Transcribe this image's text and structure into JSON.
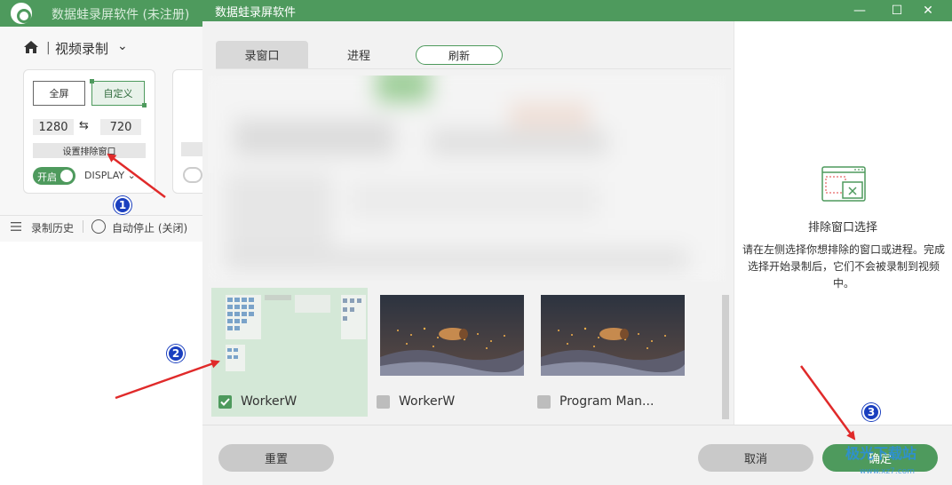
{
  "background_app": {
    "title": "数据蛙录屏软件 (未注册)",
    "mode_label": "视频录制",
    "separator": "|",
    "fullscreen_label": "全屏",
    "custom_label": "自定义",
    "width": "1280",
    "height": "720",
    "exclude_button": "设置排除窗口",
    "toggle_label": "开启",
    "display_label": "DISPLAY",
    "history_label": "录制历史",
    "autostop_label": "自动停止 (关闭)"
  },
  "dialog": {
    "title": "数据蛙录屏软件",
    "tabs": {
      "window": "录窗口",
      "process": "进程",
      "refresh": "刷新"
    },
    "thumbnails": [
      {
        "label": "WorkerW",
        "checked": true
      },
      {
        "label": "WorkerW",
        "checked": false
      },
      {
        "label": "Program Man...",
        "checked": false
      }
    ],
    "right_panel": {
      "title": "排除窗口选择",
      "description": "请在左侧选择你想排除的窗口或进程。完成选择开始录制后，它们不会被录制到视频中。"
    },
    "buttons": {
      "reset": "重置",
      "cancel": "取消",
      "ok": "确定"
    }
  },
  "annotations": {
    "badge_1": "1",
    "badge_2": "2",
    "badge_3": "3",
    "arrow_color": "#e02a2a"
  },
  "watermark": {
    "text": "极光下载站",
    "sub": "www.xz7.com"
  },
  "colors": {
    "brand_green": "#4e9a5d",
    "selected_bg": "#d4e8d7",
    "badge_blue": "#1a3fbf"
  }
}
